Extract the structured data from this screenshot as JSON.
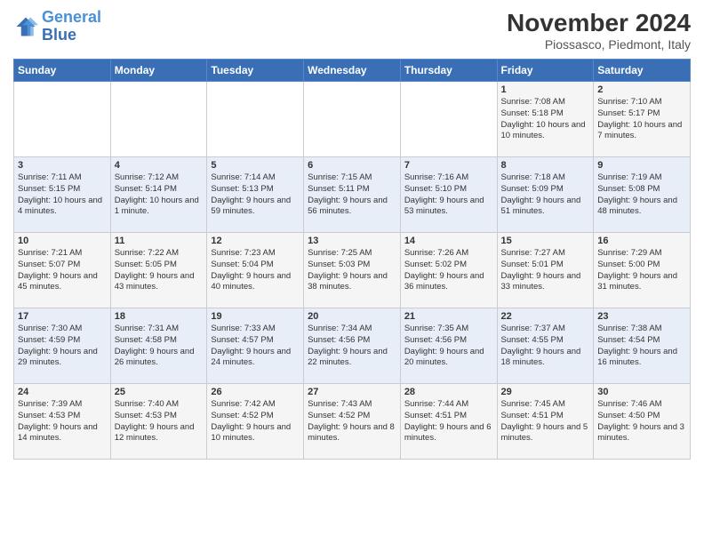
{
  "logo": {
    "line1": "General",
    "line2": "Blue"
  },
  "title": "November 2024",
  "location": "Piossasco, Piedmont, Italy",
  "days_of_week": [
    "Sunday",
    "Monday",
    "Tuesday",
    "Wednesday",
    "Thursday",
    "Friday",
    "Saturday"
  ],
  "weeks": [
    [
      {
        "day": "",
        "info": ""
      },
      {
        "day": "",
        "info": ""
      },
      {
        "day": "",
        "info": ""
      },
      {
        "day": "",
        "info": ""
      },
      {
        "day": "",
        "info": ""
      },
      {
        "day": "1",
        "info": "Sunrise: 7:08 AM\nSunset: 5:18 PM\nDaylight: 10 hours and 10 minutes."
      },
      {
        "day": "2",
        "info": "Sunrise: 7:10 AM\nSunset: 5:17 PM\nDaylight: 10 hours and 7 minutes."
      }
    ],
    [
      {
        "day": "3",
        "info": "Sunrise: 7:11 AM\nSunset: 5:15 PM\nDaylight: 10 hours and 4 minutes."
      },
      {
        "day": "4",
        "info": "Sunrise: 7:12 AM\nSunset: 5:14 PM\nDaylight: 10 hours and 1 minute."
      },
      {
        "day": "5",
        "info": "Sunrise: 7:14 AM\nSunset: 5:13 PM\nDaylight: 9 hours and 59 minutes."
      },
      {
        "day": "6",
        "info": "Sunrise: 7:15 AM\nSunset: 5:11 PM\nDaylight: 9 hours and 56 minutes."
      },
      {
        "day": "7",
        "info": "Sunrise: 7:16 AM\nSunset: 5:10 PM\nDaylight: 9 hours and 53 minutes."
      },
      {
        "day": "8",
        "info": "Sunrise: 7:18 AM\nSunset: 5:09 PM\nDaylight: 9 hours and 51 minutes."
      },
      {
        "day": "9",
        "info": "Sunrise: 7:19 AM\nSunset: 5:08 PM\nDaylight: 9 hours and 48 minutes."
      }
    ],
    [
      {
        "day": "10",
        "info": "Sunrise: 7:21 AM\nSunset: 5:07 PM\nDaylight: 9 hours and 45 minutes."
      },
      {
        "day": "11",
        "info": "Sunrise: 7:22 AM\nSunset: 5:05 PM\nDaylight: 9 hours and 43 minutes."
      },
      {
        "day": "12",
        "info": "Sunrise: 7:23 AM\nSunset: 5:04 PM\nDaylight: 9 hours and 40 minutes."
      },
      {
        "day": "13",
        "info": "Sunrise: 7:25 AM\nSunset: 5:03 PM\nDaylight: 9 hours and 38 minutes."
      },
      {
        "day": "14",
        "info": "Sunrise: 7:26 AM\nSunset: 5:02 PM\nDaylight: 9 hours and 36 minutes."
      },
      {
        "day": "15",
        "info": "Sunrise: 7:27 AM\nSunset: 5:01 PM\nDaylight: 9 hours and 33 minutes."
      },
      {
        "day": "16",
        "info": "Sunrise: 7:29 AM\nSunset: 5:00 PM\nDaylight: 9 hours and 31 minutes."
      }
    ],
    [
      {
        "day": "17",
        "info": "Sunrise: 7:30 AM\nSunset: 4:59 PM\nDaylight: 9 hours and 29 minutes."
      },
      {
        "day": "18",
        "info": "Sunrise: 7:31 AM\nSunset: 4:58 PM\nDaylight: 9 hours and 26 minutes."
      },
      {
        "day": "19",
        "info": "Sunrise: 7:33 AM\nSunset: 4:57 PM\nDaylight: 9 hours and 24 minutes."
      },
      {
        "day": "20",
        "info": "Sunrise: 7:34 AM\nSunset: 4:56 PM\nDaylight: 9 hours and 22 minutes."
      },
      {
        "day": "21",
        "info": "Sunrise: 7:35 AM\nSunset: 4:56 PM\nDaylight: 9 hours and 20 minutes."
      },
      {
        "day": "22",
        "info": "Sunrise: 7:37 AM\nSunset: 4:55 PM\nDaylight: 9 hours and 18 minutes."
      },
      {
        "day": "23",
        "info": "Sunrise: 7:38 AM\nSunset: 4:54 PM\nDaylight: 9 hours and 16 minutes."
      }
    ],
    [
      {
        "day": "24",
        "info": "Sunrise: 7:39 AM\nSunset: 4:53 PM\nDaylight: 9 hours and 14 minutes."
      },
      {
        "day": "25",
        "info": "Sunrise: 7:40 AM\nSunset: 4:53 PM\nDaylight: 9 hours and 12 minutes."
      },
      {
        "day": "26",
        "info": "Sunrise: 7:42 AM\nSunset: 4:52 PM\nDaylight: 9 hours and 10 minutes."
      },
      {
        "day": "27",
        "info": "Sunrise: 7:43 AM\nSunset: 4:52 PM\nDaylight: 9 hours and 8 minutes."
      },
      {
        "day": "28",
        "info": "Sunrise: 7:44 AM\nSunset: 4:51 PM\nDaylight: 9 hours and 6 minutes."
      },
      {
        "day": "29",
        "info": "Sunrise: 7:45 AM\nSunset: 4:51 PM\nDaylight: 9 hours and 5 minutes."
      },
      {
        "day": "30",
        "info": "Sunrise: 7:46 AM\nSunset: 4:50 PM\nDaylight: 9 hours and 3 minutes."
      }
    ]
  ]
}
